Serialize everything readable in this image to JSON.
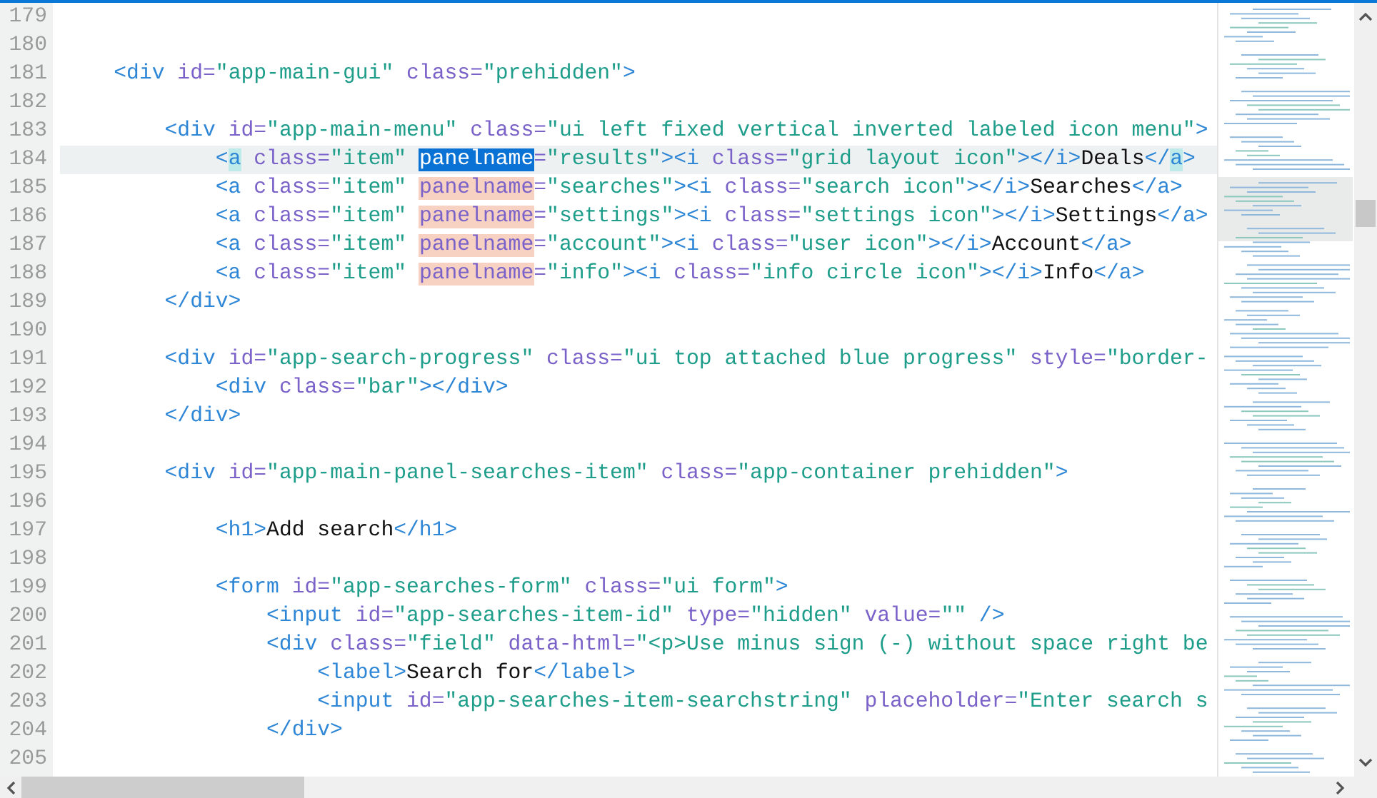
{
  "editor": {
    "lines": [
      {
        "number": "179",
        "current": false
      },
      {
        "number": "180",
        "current": false
      },
      {
        "number": "181",
        "current": false,
        "tokens": [
          {
            "kind": "tag",
            "text": "    <div"
          },
          {
            "kind": "attr",
            "text": " id="
          },
          {
            "kind": "value",
            "text": "\"app-main-gui\""
          },
          {
            "kind": "attr",
            "text": " class="
          },
          {
            "kind": "value",
            "text": "\"prehidden\""
          },
          {
            "kind": "tag",
            "text": ">"
          }
        ]
      },
      {
        "number": "182",
        "current": false
      },
      {
        "number": "183",
        "current": false,
        "tokens": [
          {
            "kind": "tag",
            "text": "        <div"
          },
          {
            "kind": "attr",
            "text": " id="
          },
          {
            "kind": "value",
            "text": "\"app-main-menu\""
          },
          {
            "kind": "attr",
            "text": " class="
          },
          {
            "kind": "value",
            "text": "\"ui left fixed vertical inverted labeled icon menu\""
          },
          {
            "kind": "tag",
            "text": ">"
          }
        ]
      },
      {
        "number": "184",
        "current": true,
        "tokens": [
          {
            "kind": "tag",
            "text": "            <"
          },
          {
            "kind": "bracket_match",
            "text": "a"
          },
          {
            "kind": "attr",
            "text": " class="
          },
          {
            "kind": "value",
            "text": "\"item\" "
          },
          {
            "kind": "selection",
            "text": "panelname"
          },
          {
            "kind": "attr",
            "text": "="
          },
          {
            "kind": "value",
            "text": "\"results\""
          },
          {
            "kind": "tag",
            "text": "><i"
          },
          {
            "kind": "attr",
            "text": " class="
          },
          {
            "kind": "value",
            "text": "\"grid layout icon\""
          },
          {
            "kind": "tag",
            "text": "></i>"
          },
          {
            "kind": "text",
            "text": "Deals"
          },
          {
            "kind": "tag",
            "text": "</"
          },
          {
            "kind": "bracket_match",
            "text": "a"
          },
          {
            "kind": "tag",
            "text": ">"
          }
        ]
      },
      {
        "number": "185",
        "current": false,
        "tokens": [
          {
            "kind": "tag",
            "text": "            <a"
          },
          {
            "kind": "attr",
            "text": " class="
          },
          {
            "kind": "value",
            "text": "\"item\" "
          },
          {
            "kind": "match",
            "text": "panelname"
          },
          {
            "kind": "attr",
            "text": "="
          },
          {
            "kind": "value",
            "text": "\"searches\""
          },
          {
            "kind": "tag",
            "text": "><i"
          },
          {
            "kind": "attr",
            "text": " class="
          },
          {
            "kind": "value",
            "text": "\"search icon\""
          },
          {
            "kind": "tag",
            "text": "></i>"
          },
          {
            "kind": "text",
            "text": "Searches"
          },
          {
            "kind": "tag",
            "text": "</a>"
          }
        ]
      },
      {
        "number": "186",
        "current": false,
        "tokens": [
          {
            "kind": "tag",
            "text": "            <a"
          },
          {
            "kind": "attr",
            "text": " class="
          },
          {
            "kind": "value",
            "text": "\"item\" "
          },
          {
            "kind": "match",
            "text": "panelname"
          },
          {
            "kind": "attr",
            "text": "="
          },
          {
            "kind": "value",
            "text": "\"settings\""
          },
          {
            "kind": "tag",
            "text": "><i"
          },
          {
            "kind": "attr",
            "text": " class="
          },
          {
            "kind": "value",
            "text": "\"settings icon\""
          },
          {
            "kind": "tag",
            "text": "></i>"
          },
          {
            "kind": "text",
            "text": "Settings"
          },
          {
            "kind": "tag",
            "text": "</a>"
          }
        ]
      },
      {
        "number": "187",
        "current": false,
        "tokens": [
          {
            "kind": "tag",
            "text": "            <a"
          },
          {
            "kind": "attr",
            "text": " class="
          },
          {
            "kind": "value",
            "text": "\"item\" "
          },
          {
            "kind": "match",
            "text": "panelname"
          },
          {
            "kind": "attr",
            "text": "="
          },
          {
            "kind": "value",
            "text": "\"account\""
          },
          {
            "kind": "tag",
            "text": "><i"
          },
          {
            "kind": "attr",
            "text": " class="
          },
          {
            "kind": "value",
            "text": "\"user icon\""
          },
          {
            "kind": "tag",
            "text": "></i>"
          },
          {
            "kind": "text",
            "text": "Account"
          },
          {
            "kind": "tag",
            "text": "</a>"
          }
        ]
      },
      {
        "number": "188",
        "current": false,
        "tokens": [
          {
            "kind": "tag",
            "text": "            <a"
          },
          {
            "kind": "attr",
            "text": " class="
          },
          {
            "kind": "value",
            "text": "\"item\" "
          },
          {
            "kind": "match",
            "text": "panelname"
          },
          {
            "kind": "attr",
            "text": "="
          },
          {
            "kind": "value",
            "text": "\"info\""
          },
          {
            "kind": "tag",
            "text": "><i"
          },
          {
            "kind": "attr",
            "text": " class="
          },
          {
            "kind": "value",
            "text": "\"info circle icon\""
          },
          {
            "kind": "tag",
            "text": "></i>"
          },
          {
            "kind": "text",
            "text": "Info"
          },
          {
            "kind": "tag",
            "text": "</a>"
          }
        ]
      },
      {
        "number": "189",
        "current": false,
        "tokens": [
          {
            "kind": "tag",
            "text": "        </div>"
          }
        ]
      },
      {
        "number": "190",
        "current": false
      },
      {
        "number": "191",
        "current": false,
        "tokens": [
          {
            "kind": "tag",
            "text": "        <div"
          },
          {
            "kind": "attr",
            "text": " id="
          },
          {
            "kind": "value",
            "text": "\"app-search-progress\""
          },
          {
            "kind": "attr",
            "text": " class="
          },
          {
            "kind": "value",
            "text": "\"ui top attached blue progress\""
          },
          {
            "kind": "attr",
            "text": " style="
          },
          {
            "kind": "value",
            "text": "\"border-"
          }
        ]
      },
      {
        "number": "192",
        "current": false,
        "tokens": [
          {
            "kind": "tag",
            "text": "            <div"
          },
          {
            "kind": "attr",
            "text": " class="
          },
          {
            "kind": "value",
            "text": "\"bar\""
          },
          {
            "kind": "tag",
            "text": "></div>"
          }
        ]
      },
      {
        "number": "193",
        "current": false,
        "tokens": [
          {
            "kind": "tag",
            "text": "        </div>"
          }
        ]
      },
      {
        "number": "194",
        "current": false
      },
      {
        "number": "195",
        "current": false,
        "tokens": [
          {
            "kind": "tag",
            "text": "        <div"
          },
          {
            "kind": "attr",
            "text": " id="
          },
          {
            "kind": "value",
            "text": "\"app-main-panel-searches-item\""
          },
          {
            "kind": "attr",
            "text": " class="
          },
          {
            "kind": "value",
            "text": "\"app-container prehidden\""
          },
          {
            "kind": "tag",
            "text": ">"
          }
        ]
      },
      {
        "number": "196",
        "current": false
      },
      {
        "number": "197",
        "current": false,
        "tokens": [
          {
            "kind": "tag",
            "text": "            <h1>"
          },
          {
            "kind": "text",
            "text": "Add search"
          },
          {
            "kind": "tag",
            "text": "</h1>"
          }
        ]
      },
      {
        "number": "198",
        "current": false
      },
      {
        "number": "199",
        "current": false,
        "tokens": [
          {
            "kind": "tag",
            "text": "            <form"
          },
          {
            "kind": "attr",
            "text": " id="
          },
          {
            "kind": "value",
            "text": "\"app-searches-form\""
          },
          {
            "kind": "attr",
            "text": " class="
          },
          {
            "kind": "value",
            "text": "\"ui form\""
          },
          {
            "kind": "tag",
            "text": ">"
          }
        ]
      },
      {
        "number": "200",
        "current": false,
        "tokens": [
          {
            "kind": "tag",
            "text": "                <input"
          },
          {
            "kind": "attr",
            "text": " id="
          },
          {
            "kind": "value",
            "text": "\"app-searches-item-id\""
          },
          {
            "kind": "attr",
            "text": " type="
          },
          {
            "kind": "value",
            "text": "\"hidden\""
          },
          {
            "kind": "attr",
            "text": " value="
          },
          {
            "kind": "value",
            "text": "\"\""
          },
          {
            "kind": "tag",
            "text": " />"
          }
        ]
      },
      {
        "number": "201",
        "current": false,
        "tokens": [
          {
            "kind": "tag",
            "text": "                <div"
          },
          {
            "kind": "attr",
            "text": " class="
          },
          {
            "kind": "value",
            "text": "\"field\""
          },
          {
            "kind": "attr",
            "text": " data-html="
          },
          {
            "kind": "value",
            "text": "\"<p>Use minus sign (-) without space right be"
          }
        ]
      },
      {
        "number": "202",
        "current": false,
        "tokens": [
          {
            "kind": "tag",
            "text": "                    <label>"
          },
          {
            "kind": "text",
            "text": "Search for"
          },
          {
            "kind": "tag",
            "text": "</label>"
          }
        ]
      },
      {
        "number": "203",
        "current": false,
        "tokens": [
          {
            "kind": "tag",
            "text": "                    <input"
          },
          {
            "kind": "attr",
            "text": " id="
          },
          {
            "kind": "value",
            "text": "\"app-searches-item-searchstring\""
          },
          {
            "kind": "attr",
            "text": " placeholder="
          },
          {
            "kind": "value",
            "text": "\"Enter search s"
          }
        ]
      },
      {
        "number": "204",
        "current": false,
        "tokens": [
          {
            "kind": "tag",
            "text": "                </div>"
          }
        ]
      },
      {
        "number": "205",
        "current": false
      }
    ]
  }
}
